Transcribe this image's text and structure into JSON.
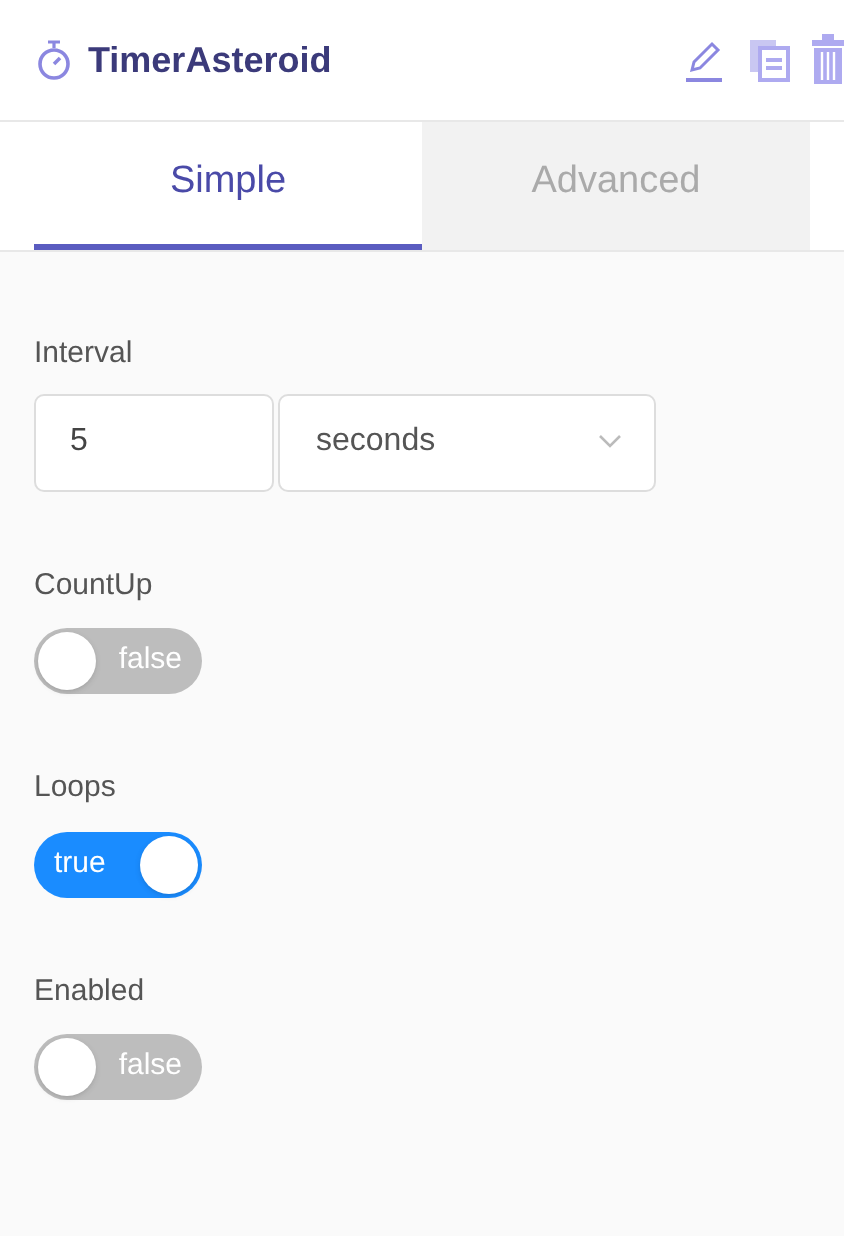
{
  "header": {
    "title": "TimerAsteroid"
  },
  "tabs": [
    {
      "label": "Simple",
      "selected": true
    },
    {
      "label": "Advanced",
      "selected": false
    }
  ],
  "fields": [
    {
      "kind": "duration",
      "label": "Interval",
      "value": "5",
      "unit": "seconds"
    },
    {
      "kind": "toggle",
      "label": "CountUp",
      "on": false,
      "state_text": "false"
    },
    {
      "kind": "toggle",
      "label": "Loops",
      "on": true,
      "state_text": "true"
    },
    {
      "kind": "toggle",
      "label": "Enabled",
      "on": false,
      "state_text": "false"
    }
  ]
}
